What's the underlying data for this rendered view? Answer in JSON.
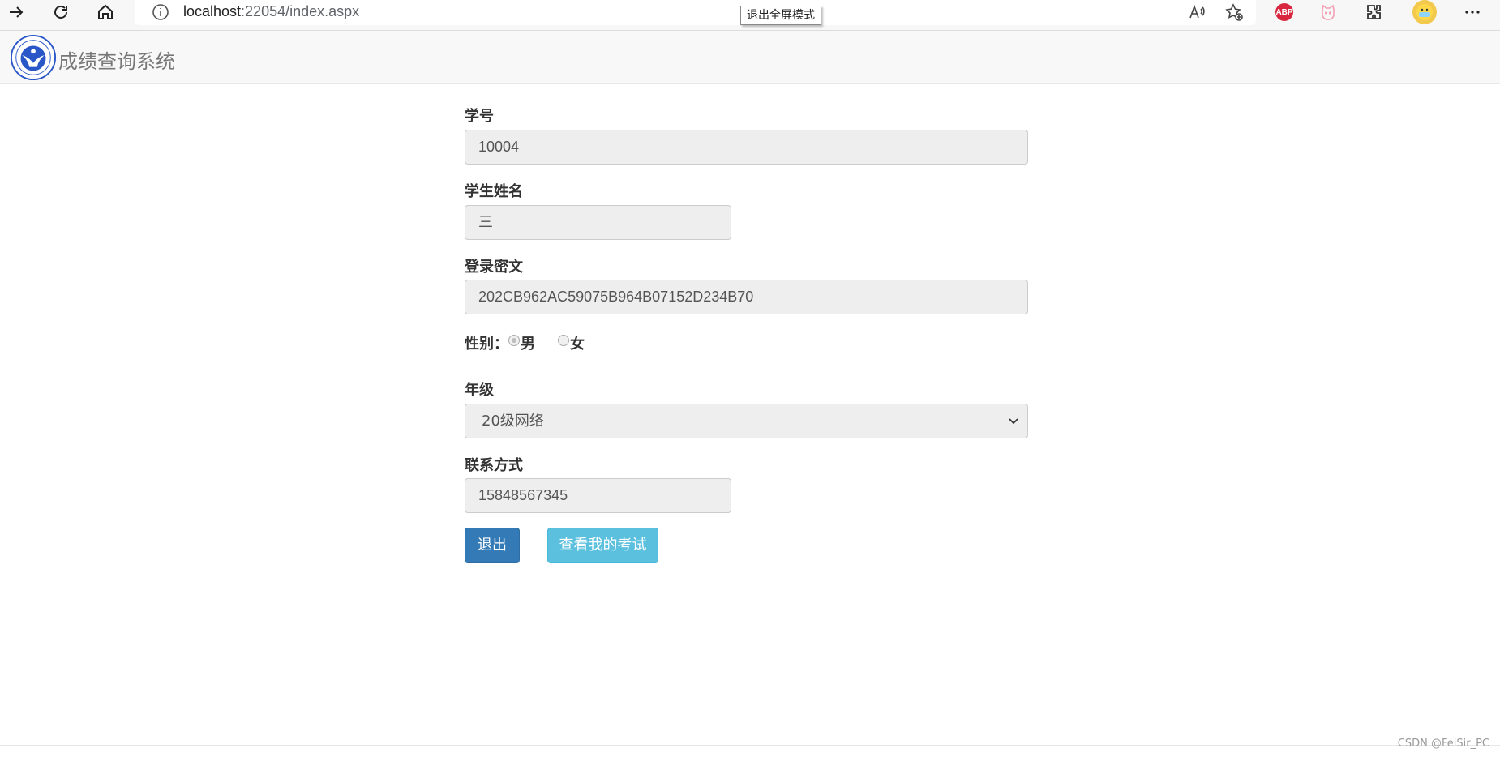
{
  "browser": {
    "url_host": "localhost",
    "url_path": ":22054/index.aspx",
    "tooltip": "退出全屏模式",
    "abp_label": "ABP",
    "icons": [
      "forward-icon",
      "refresh-icon",
      "home-icon",
      "info-icon",
      "read-aloud-icon",
      "add-favorite-icon",
      "adblock-icon",
      "cat-extension-icon",
      "extensions-icon",
      "profile-icon",
      "more-icon"
    ]
  },
  "navbar": {
    "brand": "成绩查询系统"
  },
  "form": {
    "student_id_label": "学号",
    "student_id_value": "10004",
    "student_name_label": "学生姓名",
    "student_name_value": "三",
    "password_label": "登录密文",
    "password_value": "202CB962AC59075B964B07152D234B70",
    "gender_label": "性别：",
    "gender_options": [
      "男",
      "女"
    ],
    "gender_selected": "男",
    "grade_label": "年级",
    "grade_value": "20级网络",
    "contact_label": "联系方式",
    "contact_value": "15848567345",
    "logout_button": "退出",
    "exam_button": "查看我的考试"
  },
  "watermark": "CSDN @FeiSir_PC",
  "colors": {
    "primary": "#337ab7",
    "info": "#5bc0de",
    "input_bg": "#eeeeee",
    "navbar_bg": "#f8f8f8"
  }
}
